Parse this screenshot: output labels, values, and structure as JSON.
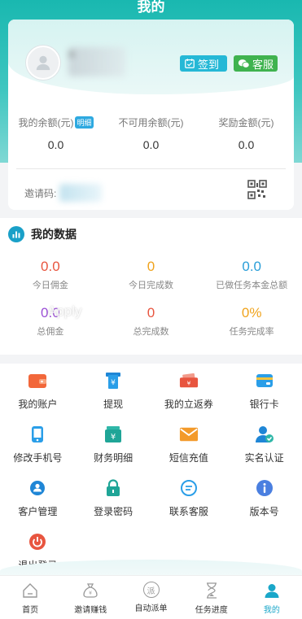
{
  "header": {
    "title": "我的"
  },
  "profile": {
    "username": "a",
    "sign_in_label": "签到",
    "service_label": "客服"
  },
  "balances": [
    {
      "label": "我的余额(元)",
      "value": "0.0",
      "tag": "明细"
    },
    {
      "label": "不可用余额(元)",
      "value": "0.0"
    },
    {
      "label": "奖励金额(元)",
      "value": "0.0"
    }
  ],
  "invite": {
    "label": "邀请码:"
  },
  "my_data": {
    "title": "我的数据",
    "row1": [
      {
        "value": "0.0",
        "label": "今日佣金"
      },
      {
        "value": "0",
        "label": "今日完成数"
      },
      {
        "value": "0.0",
        "label": "已做任务本金总额"
      }
    ],
    "row2": [
      {
        "value": "0.0",
        "label": "总佣金"
      },
      {
        "value": "0",
        "label": "总完成数"
      },
      {
        "value": "0%",
        "label": "任务完成率"
      }
    ],
    "watermark": "Apply"
  },
  "menu": {
    "items": [
      {
        "label": "我的账户",
        "icon": "wallet-icon"
      },
      {
        "label": "提现",
        "icon": "withdraw-icon"
      },
      {
        "label": "我的立返券",
        "icon": "coupon-icon"
      },
      {
        "label": "银行卡",
        "icon": "bank-card-icon"
      },
      {
        "label": "修改手机号",
        "icon": "phone-icon"
      },
      {
        "label": "财务明细",
        "icon": "finance-icon"
      },
      {
        "label": "短信充值",
        "icon": "sms-icon"
      },
      {
        "label": "实名认证",
        "icon": "verify-icon"
      },
      {
        "label": "客户管理",
        "icon": "customer-icon"
      },
      {
        "label": "登录密码",
        "icon": "lock-icon"
      },
      {
        "label": "联系客服",
        "icon": "chat-icon"
      },
      {
        "label": "版本号",
        "icon": "info-icon"
      },
      {
        "label": "退出登录",
        "icon": "power-icon"
      }
    ]
  },
  "tabbar": {
    "tabs": [
      {
        "label": "首页",
        "icon": "home-icon"
      },
      {
        "label": "邀请赚钱",
        "icon": "money-bag-icon"
      },
      {
        "label": "自动派单",
        "icon": "dispatch-icon",
        "icon_text": "派"
      },
      {
        "label": "任务进度",
        "icon": "hourglass-icon"
      },
      {
        "label": "我的",
        "icon": "user-icon",
        "active": true
      }
    ]
  },
  "colors": {
    "accent": "#1aa7c9",
    "header": "#19b8b0",
    "red": "#e8553f",
    "orange": "#f0a31c",
    "blue": "#2a9ed8"
  }
}
